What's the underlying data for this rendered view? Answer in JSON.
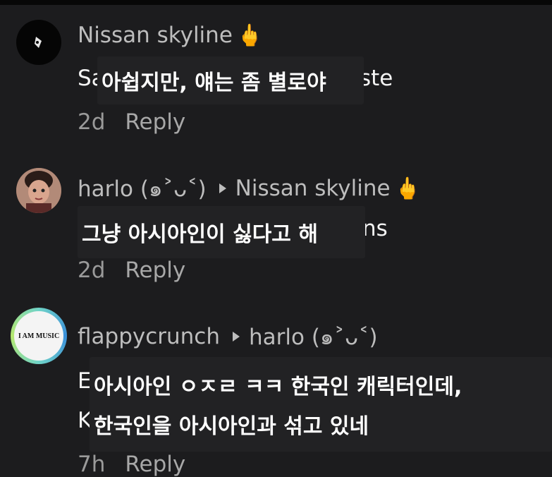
{
  "colors": {
    "background": "#1c1c1e",
    "username": "#bdbdbd",
    "meta": "#9a9a9a",
    "overlay": "#222224"
  },
  "comments": [
    {
      "username": "Nissan skyline",
      "emoji": "🖕",
      "text_visible_left": "Sa",
      "text_visible_right": "ste",
      "translation": "아쉽지만, 얘는 좀 별로야",
      "age": "2d",
      "reply_label": "Reply"
    },
    {
      "username": "harlo (๑˃ᴗ˂)",
      "reply_to": "Nissan skyline",
      "emoji": "🖕",
      "text_visible_right": "ns",
      "translation": "그냥 아시아인이 싫다고 해",
      "age": "2d",
      "reply_label": "Reply"
    },
    {
      "username": "flappycrunch",
      "reply_to": "harlo (๑˃ᴗ˂)",
      "avatar_text": "I AM MUSIC",
      "text_line1_left": "E",
      "text_line2_left": "K",
      "translation_line1": "아시아인 ㅇㅈㄹ ㅋㅋ 한국인 캐릭터인데,",
      "translation_line2": "한국인을 아시아인과 섞고 있네",
      "age": "7h",
      "reply_label": "Reply"
    }
  ]
}
